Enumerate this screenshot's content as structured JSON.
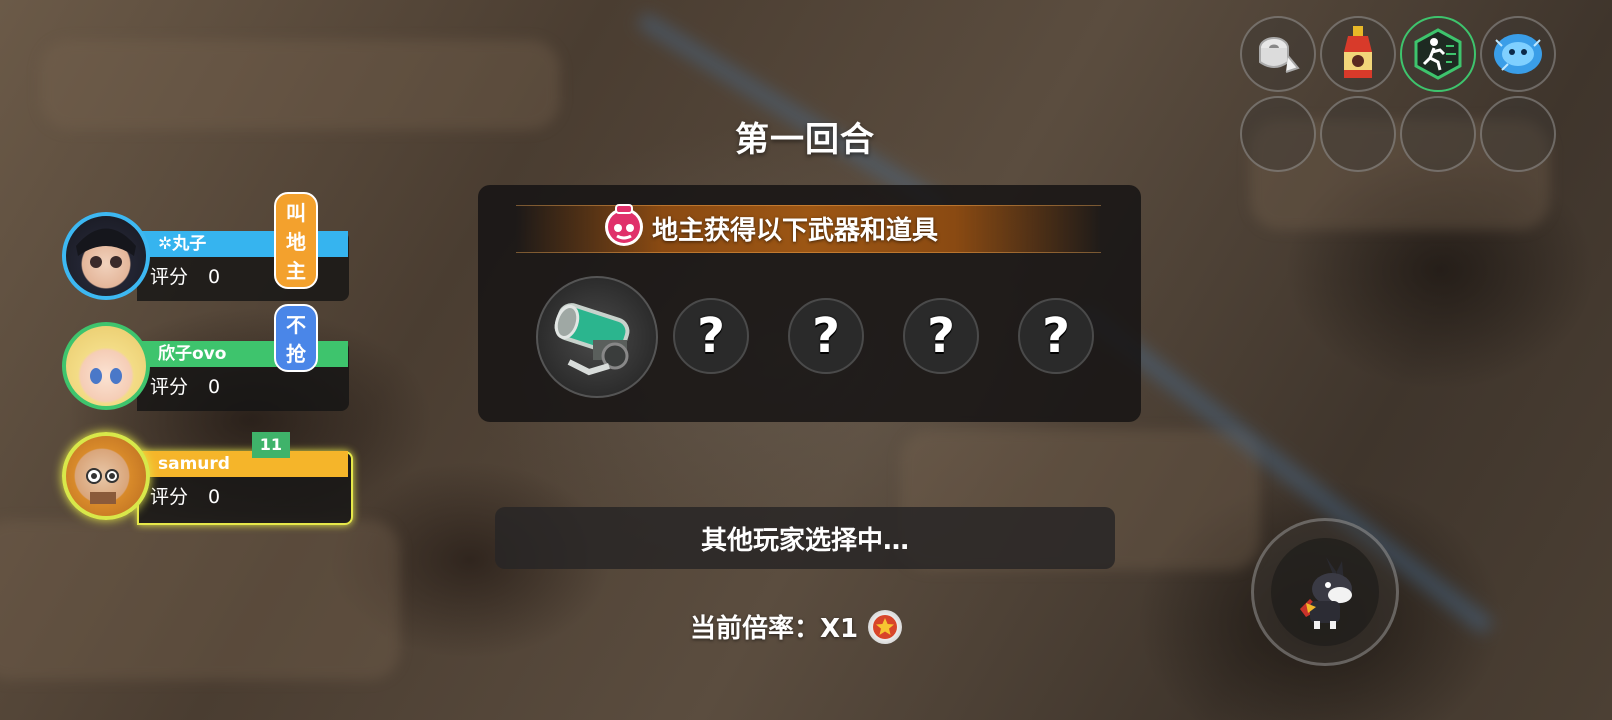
{
  "round": {
    "title": "第一回合"
  },
  "reward_panel": {
    "banner_text": "地主获得以下武器和道具",
    "weapon_icon": "cannon-icon",
    "unknown_slots": [
      "?",
      "?",
      "?",
      "?"
    ]
  },
  "status": {
    "text": "其他玩家选择中…"
  },
  "multiplier": {
    "label": "当前倍率：",
    "value": "X1",
    "icon": "star-badge-icon"
  },
  "players": [
    {
      "name": "✲丸子",
      "score_label": "评分",
      "score": "0",
      "bubble": "叫地主",
      "name_color": "#3db8f2"
    },
    {
      "name": "欣子ovo",
      "score_label": "评分",
      "score": "0",
      "bubble": "不抢",
      "name_color": "#3ec46d"
    },
    {
      "name": "samurd",
      "score_label": "评分",
      "score": "0",
      "level": "11",
      "name_color": "#f5b52a"
    }
  ],
  "items": [
    "toilet-paper-icon",
    "hot-sauce-bottle-icon",
    "running-man-icon",
    "blue-spirit-icon",
    "empty-slot",
    "empty-slot",
    "empty-slot",
    "empty-slot"
  ],
  "pet_button": {
    "icon": "dog-pet-icon"
  }
}
